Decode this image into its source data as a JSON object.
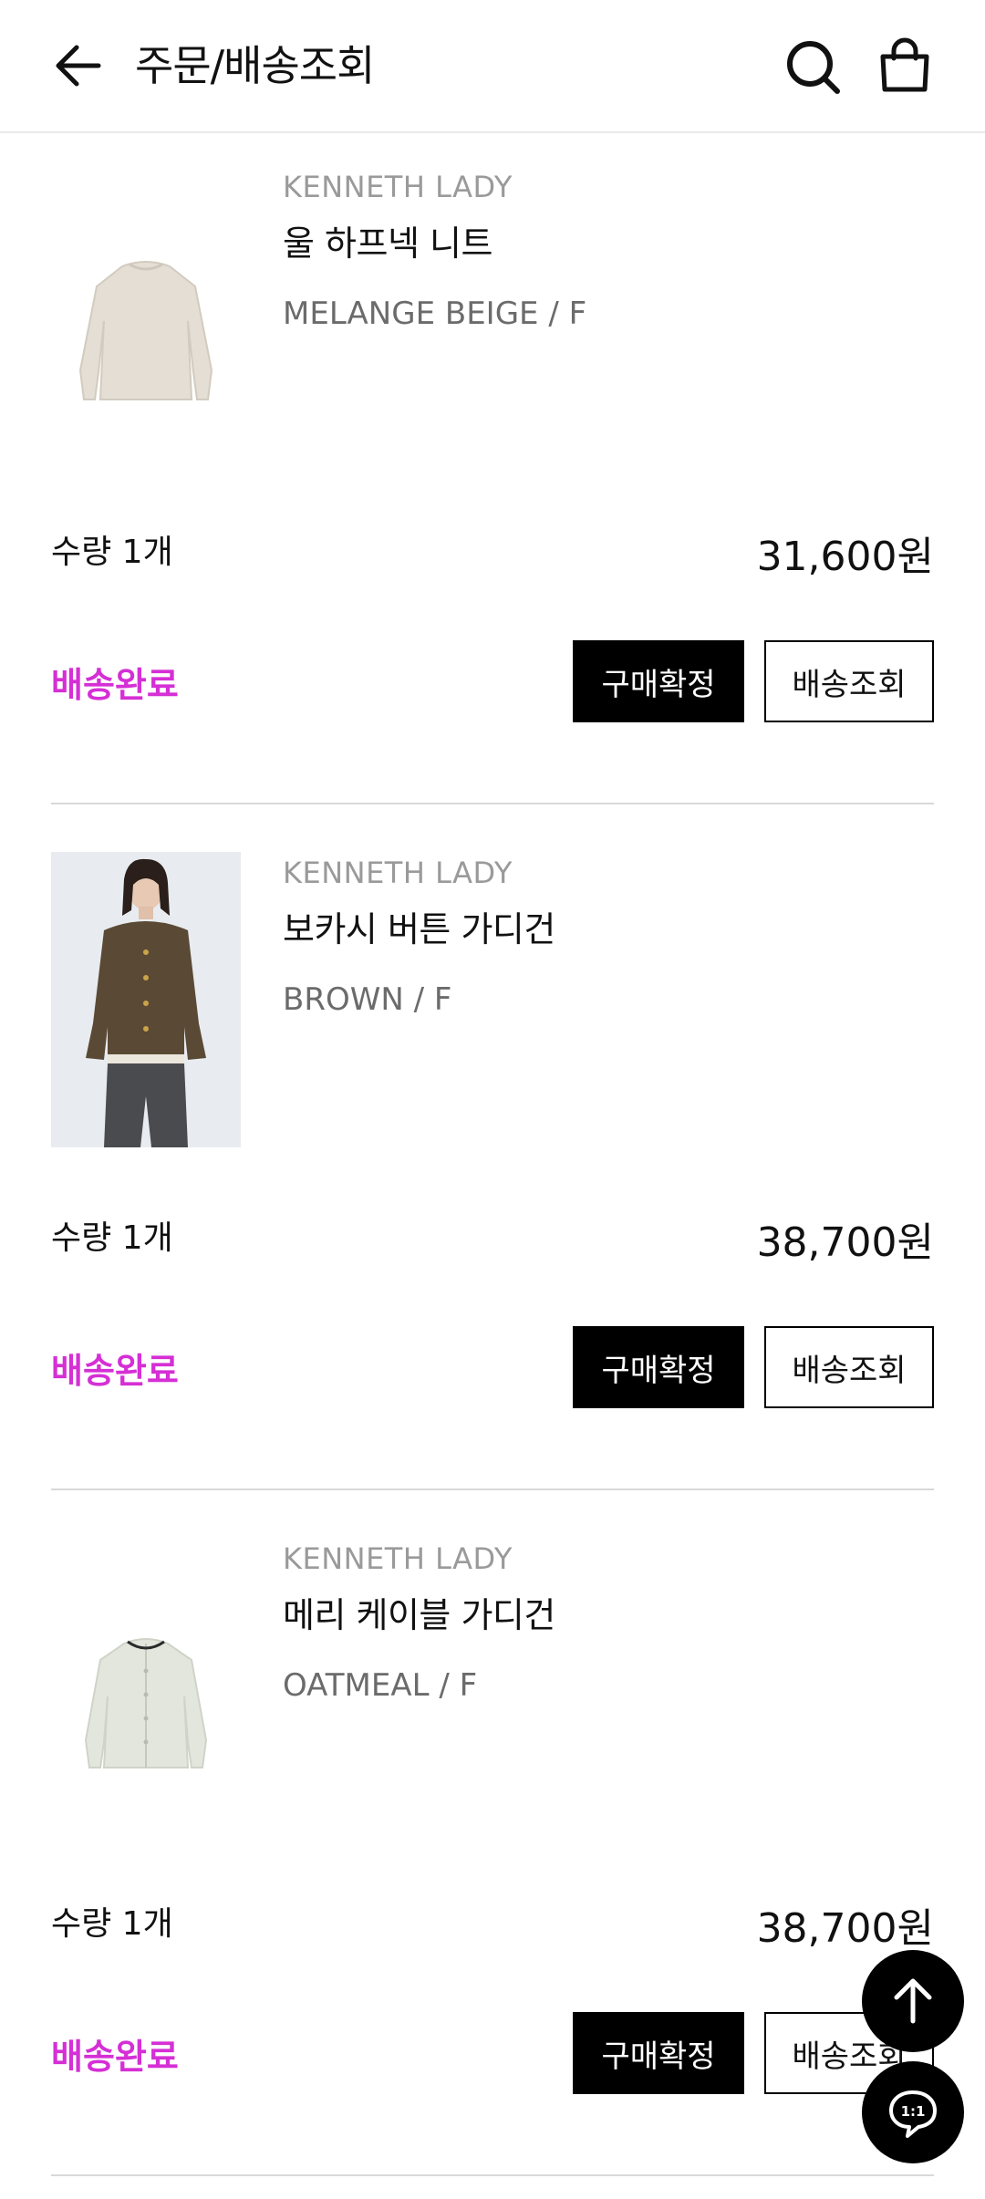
{
  "header": {
    "title": "주문/배송조회",
    "back_icon": "arrow-left-icon",
    "search_icon": "search-icon",
    "cart_icon": "shopping-bag-icon"
  },
  "items": [
    {
      "brand": "KENNETH LADY",
      "name": "울 하프넥 니트",
      "option": "MELANGE BEIGE / F",
      "quantity": "수량 1개",
      "price": "31,600원",
      "status": "배송완료",
      "confirm_label": "구매확정",
      "track_label": "배송조회"
    },
    {
      "brand": "KENNETH LADY",
      "name": "보카시 버튼 가디건",
      "option": "BROWN / F",
      "quantity": "수량 1개",
      "price": "38,700원",
      "status": "배송완료",
      "confirm_label": "구매확정",
      "track_label": "배송조회"
    },
    {
      "brand": "KENNETH LADY",
      "name": "메리 케이블 가디건",
      "option": "OATMEAL / F",
      "quantity": "수량 1개",
      "price": "38,700원",
      "status": "배송완료",
      "confirm_label": "구매확정",
      "track_label": "배송조회"
    }
  ],
  "floating": {
    "scroll_top_icon": "arrow-up-icon",
    "chat_label": "1:1",
    "chat_icon": "chat-bubble-icon"
  },
  "colors": {
    "status": "#d52fd5",
    "primary_button": "#000000",
    "divider": "#d9d9d9"
  }
}
